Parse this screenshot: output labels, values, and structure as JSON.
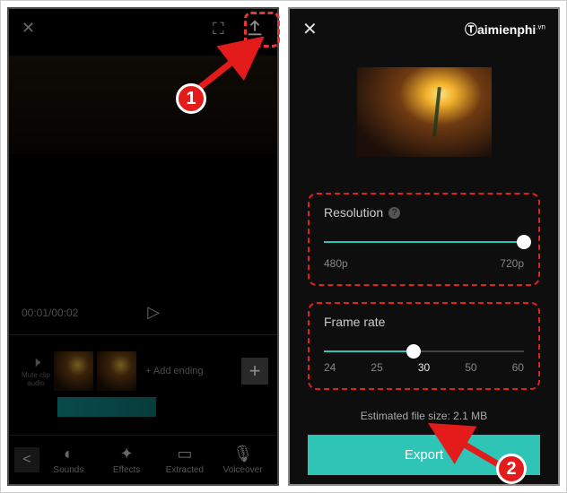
{
  "left": {
    "time": "00:01/00:02",
    "muteLabel": "Mute clip audio",
    "addEnding": "+ Add ending",
    "bottom": {
      "sounds": "Sounds",
      "effects": "Effects",
      "extracted": "Extracted",
      "voiceover": "Voiceover"
    }
  },
  "right": {
    "watermark": "Ⓣaimienphi",
    "watermarkSup": ".vn",
    "resolution": {
      "label": "Resolution",
      "min": "480p",
      "max": "720p",
      "valuePercent": 100
    },
    "frameRate": {
      "label": "Frame rate",
      "ticks": [
        "24",
        "25",
        "30",
        "50",
        "60"
      ],
      "activeIndex": 2,
      "valuePercent": 45
    },
    "estimated": "Estimated file size: 2.1 MB",
    "exportLabel": "Export"
  },
  "anno": {
    "badge1": "1",
    "badge2": "2"
  }
}
